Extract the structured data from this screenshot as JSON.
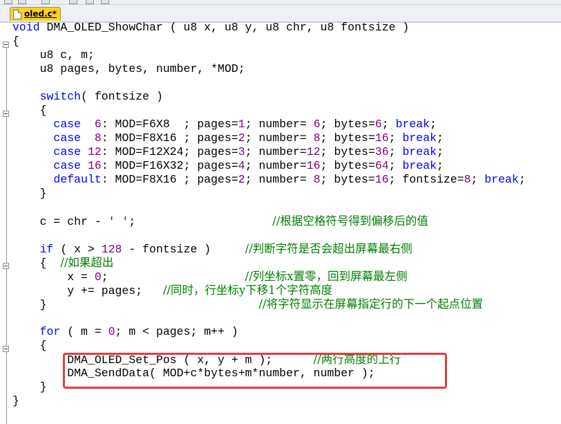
{
  "editor": {
    "tab_label": "oled.c*",
    "accent_color": "#ffd21c",
    "highlight_color": "#e23c3c",
    "lines": [
      [
        {
          "t": "void",
          "c": "kw"
        },
        {
          "t": " DMA_OLED_ShowChar ( u8 x, u8 y, u8 chr, u8 fontsize )"
        }
      ],
      [
        {
          "t": "{"
        }
      ],
      [
        {
          "t": "    u8 c, m;"
        }
      ],
      [
        {
          "t": "    u8 pages, bytes, number, *MOD;"
        }
      ],
      [],
      [
        {
          "t": "    "
        },
        {
          "t": "switch",
          "c": "kw"
        },
        {
          "t": "( fontsize )"
        }
      ],
      [
        {
          "t": "    {"
        }
      ],
      [
        {
          "t": "      "
        },
        {
          "t": "case",
          "c": "kw"
        },
        {
          "t": "  "
        },
        {
          "t": "6",
          "c": "num"
        },
        {
          "t": ": MOD=F6X8  ; pages="
        },
        {
          "t": "1",
          "c": "num"
        },
        {
          "t": "; number= "
        },
        {
          "t": "6",
          "c": "num"
        },
        {
          "t": "; bytes="
        },
        {
          "t": "6",
          "c": "num"
        },
        {
          "t": "; "
        },
        {
          "t": "break",
          "c": "kw"
        },
        {
          "t": ";"
        }
      ],
      [
        {
          "t": "      "
        },
        {
          "t": "case",
          "c": "kw"
        },
        {
          "t": "  "
        },
        {
          "t": "8",
          "c": "num"
        },
        {
          "t": ": MOD=F8X16 ; pages="
        },
        {
          "t": "2",
          "c": "num"
        },
        {
          "t": "; number= "
        },
        {
          "t": "8",
          "c": "num"
        },
        {
          "t": "; bytes="
        },
        {
          "t": "16",
          "c": "num"
        },
        {
          "t": "; "
        },
        {
          "t": "break",
          "c": "kw"
        },
        {
          "t": ";"
        }
      ],
      [
        {
          "t": "      "
        },
        {
          "t": "case",
          "c": "kw"
        },
        {
          "t": " "
        },
        {
          "t": "12",
          "c": "num"
        },
        {
          "t": ": MOD=F12X24; pages="
        },
        {
          "t": "3",
          "c": "num"
        },
        {
          "t": "; number="
        },
        {
          "t": "12",
          "c": "num"
        },
        {
          "t": "; bytes="
        },
        {
          "t": "36",
          "c": "num"
        },
        {
          "t": "; "
        },
        {
          "t": "break",
          "c": "kw"
        },
        {
          "t": ";"
        }
      ],
      [
        {
          "t": "      "
        },
        {
          "t": "case",
          "c": "kw"
        },
        {
          "t": " "
        },
        {
          "t": "16",
          "c": "num"
        },
        {
          "t": ": MOD=F16X32; pages="
        },
        {
          "t": "4",
          "c": "num"
        },
        {
          "t": "; number="
        },
        {
          "t": "16",
          "c": "num"
        },
        {
          "t": "; bytes="
        },
        {
          "t": "64",
          "c": "num"
        },
        {
          "t": "; "
        },
        {
          "t": "break",
          "c": "kw"
        },
        {
          "t": ";"
        }
      ],
      [
        {
          "t": "      "
        },
        {
          "t": "default",
          "c": "kw"
        },
        {
          "t": ": MOD=F8X16 ; pages="
        },
        {
          "t": "2",
          "c": "num"
        },
        {
          "t": "; number= "
        },
        {
          "t": "8",
          "c": "num"
        },
        {
          "t": "; bytes="
        },
        {
          "t": "16",
          "c": "num"
        },
        {
          "t": "; fontsize="
        },
        {
          "t": "8",
          "c": "num"
        },
        {
          "t": "; "
        },
        {
          "t": "break",
          "c": "kw"
        },
        {
          "t": ";"
        }
      ],
      [
        {
          "t": "    }"
        }
      ],
      [],
      [
        {
          "t": "    c = chr - "
        },
        {
          "t": "' '",
          "c": "str"
        },
        {
          "t": ";                    "
        },
        {
          "t": "//根据空格符号得到偏移后的值",
          "c": "cm"
        }
      ],
      [],
      [
        {
          "t": "    "
        },
        {
          "t": "if",
          "c": "kw"
        },
        {
          "t": " ( x > "
        },
        {
          "t": "128",
          "c": "num"
        },
        {
          "t": " - fontsize )     "
        },
        {
          "t": "//判断字符是否会超出屏幕最右侧",
          "c": "cm"
        }
      ],
      [
        {
          "t": "    {  "
        },
        {
          "t": "//如果超出",
          "c": "cm"
        }
      ],
      [
        {
          "t": "        x = "
        },
        {
          "t": "0",
          "c": "num"
        },
        {
          "t": ";                    "
        },
        {
          "t": "//列坐标x置零，回到屏幕最左侧",
          "c": "cm"
        }
      ],
      [
        {
          "t": "        y += pages;   "
        },
        {
          "t": "//同时，行坐标y下移1个字符高度",
          "c": "cm"
        }
      ],
      [
        {
          "t": "    }                               "
        },
        {
          "t": "//将字符显示在屏幕指定行的下一个起点位置",
          "c": "cm"
        }
      ],
      [],
      [
        {
          "t": "    "
        },
        {
          "t": "for",
          "c": "kw"
        },
        {
          "t": " ( m = "
        },
        {
          "t": "0",
          "c": "num"
        },
        {
          "t": "; m < pages; m++ )"
        }
      ],
      [
        {
          "t": "    {"
        }
      ],
      [
        {
          "t": "        DMA_OLED_Set_Pos ( x, y + m );      "
        },
        {
          "t": "//两行高度的上行",
          "c": "cm"
        }
      ],
      [
        {
          "t": "        DMA_SendData( MOD+c*bytes+m*number, number );"
        }
      ],
      [
        {
          "t": "    }"
        }
      ],
      [
        {
          "t": "}"
        }
      ]
    ]
  }
}
